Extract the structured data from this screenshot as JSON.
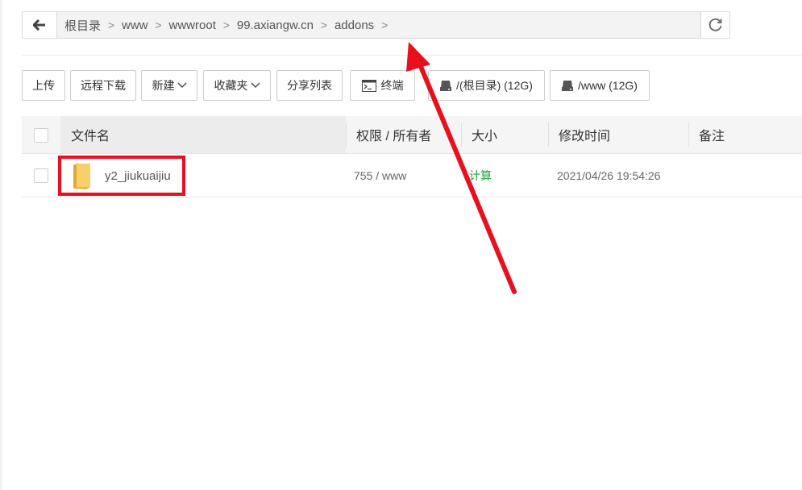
{
  "breadcrumb": {
    "items": [
      "根目录",
      "www",
      "wwwroot",
      "99.axiangw.cn",
      "addons"
    ],
    "separator": ">"
  },
  "toolbar": {
    "upload": "上传",
    "remote_download": "远程下载",
    "new": "新建",
    "favorites": "收藏夹",
    "share_list": "分享列表",
    "terminal": "终端",
    "disk_root": "/(根目录) (12G)",
    "disk_www": "/www (12G)"
  },
  "table": {
    "headers": {
      "name": "文件名",
      "perm": "权限 / 所有者",
      "size": "大小",
      "mtime": "修改时间",
      "note": "备注"
    },
    "rows": [
      {
        "name": "y2_jiukuaijiu",
        "perm": "755 / www",
        "size": "计算",
        "mtime": "2021/04/26 19:54:26",
        "note": ""
      }
    ]
  },
  "colors": {
    "folder": "#f5c542",
    "size_link": "#20a53a",
    "annotation": "#e8101c"
  },
  "icons": {
    "back": "arrow-left-icon",
    "refresh": "refresh-icon",
    "terminal": "terminal-icon",
    "disk": "disk-icon",
    "folder": "folder-icon",
    "dropdown": "chevron-down-icon"
  }
}
